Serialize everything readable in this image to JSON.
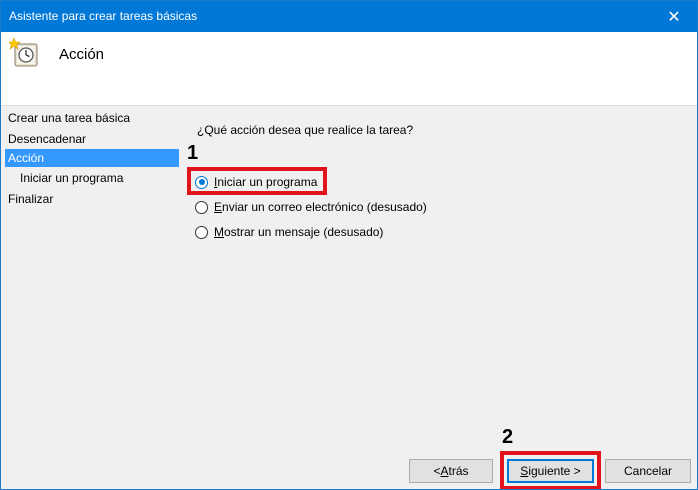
{
  "window": {
    "title": "Asistente para crear tareas básicas",
    "close_glyph": "✕"
  },
  "header": {
    "icon": "task-scheduler-clock-icon",
    "title": "Acción"
  },
  "sidebar": {
    "items": [
      {
        "label": "Crear una tarea básica"
      },
      {
        "label": "Desencadenar"
      },
      {
        "label": "Acción"
      },
      {
        "label": "Iniciar un programa"
      },
      {
        "label": "Finalizar"
      }
    ]
  },
  "main": {
    "question": "¿Qué acción desea que realice la tarea?",
    "options": [
      {
        "underline": "I",
        "rest": "niciar un programa",
        "checked": true
      },
      {
        "underline": "E",
        "rest": "nviar un correo electrónico (desusado)",
        "checked": false
      },
      {
        "underline": "M",
        "rest": "ostrar un mensaje (desusado)",
        "checked": false
      }
    ]
  },
  "buttons": {
    "back_underline": "A",
    "back_prefix": "< ",
    "back_rest": "trás",
    "next_underline": "S",
    "next_rest": "iguiente >",
    "cancel": "Cancelar"
  },
  "annotations": {
    "step1": "1",
    "step2": "2",
    "highlight_color": "#e2141b"
  },
  "colors": {
    "titlebar": "#0078d7",
    "selection": "#3399ff"
  }
}
